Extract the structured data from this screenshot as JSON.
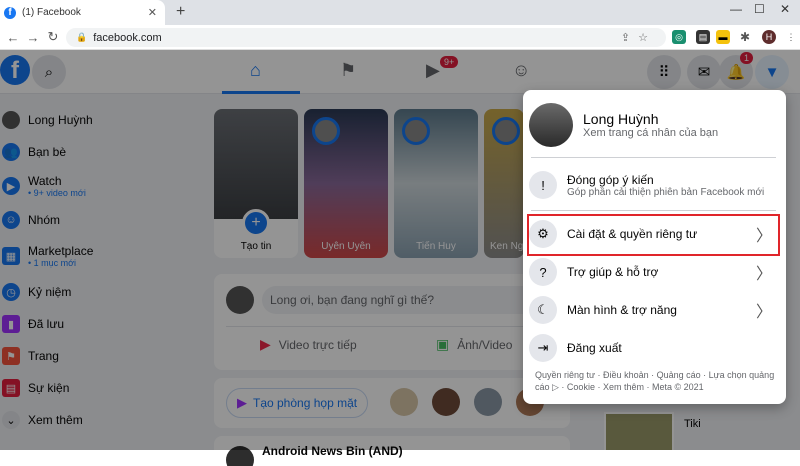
{
  "browser": {
    "tab_title": "(1) Facebook",
    "tab_close": "✕",
    "new_tab": "+",
    "url": "facebook.com",
    "profile_initial": "H",
    "ext_badge": "1"
  },
  "header": {
    "logo_letter": "f",
    "watch_badge": "9+",
    "notif_badge": "1"
  },
  "sidebar": {
    "items": [
      {
        "label": "Long Huỳnh",
        "sub": "",
        "icon": "avatar"
      },
      {
        "label": "Bạn bè",
        "sub": "",
        "icon": "friends-icon"
      },
      {
        "label": "Watch",
        "sub": "• 9+ video mới",
        "icon": "watch-icon"
      },
      {
        "label": "Nhóm",
        "sub": "",
        "icon": "groups-icon"
      },
      {
        "label": "Marketplace",
        "sub": "• 1 mục mới",
        "icon": "marketplace-icon"
      },
      {
        "label": "Kỷ niệm",
        "sub": "",
        "icon": "memories-icon"
      },
      {
        "label": "Đã lưu",
        "sub": "",
        "icon": "saved-icon"
      },
      {
        "label": "Trang",
        "sub": "",
        "icon": "pages-icon"
      },
      {
        "label": "Sự kiện",
        "sub": "",
        "icon": "events-icon"
      },
      {
        "label": "Xem thêm",
        "sub": "",
        "icon": "chevron-down-icon"
      }
    ]
  },
  "stories": [
    {
      "label": "Tạo tin"
    },
    {
      "label": "Uyên Uyên"
    },
    {
      "label": "Tiến Huy"
    },
    {
      "label": "Ken Ng"
    }
  ],
  "composer": {
    "placeholder": "Long ơi, bạn đang nghĩ gì thế?",
    "live_video": "Video trực tiếp",
    "photo_video": "Ảnh/Video"
  },
  "rooms": {
    "create_room": "Tạo phòng họp mặt"
  },
  "bottom_post": {
    "author_partial": "Android News Bin (AND)"
  },
  "right_col": {
    "partial_label": "Tiki"
  },
  "menu": {
    "profile_name": "Long Huỳnh",
    "profile_sub": "Xem trang cá nhân của bạn",
    "feedback_title": "Đóng góp ý kiến",
    "feedback_sub": "Góp phần cải thiện phiên bản Facebook mới",
    "settings": "Cài đặt & quyền riêng tư",
    "help": "Trợ giúp & hỗ trợ",
    "display": "Màn hình & trợ năng",
    "logout": "Đăng xuất",
    "footer": "Quyền riêng tư · Điều khoản · Quảng cáo · Lựa chọn quảng cáo ▷ · Cookie · Xem thêm · Meta © 2021"
  },
  "colors": {
    "accent": "#1877f2",
    "highlight": "#e0252a"
  }
}
